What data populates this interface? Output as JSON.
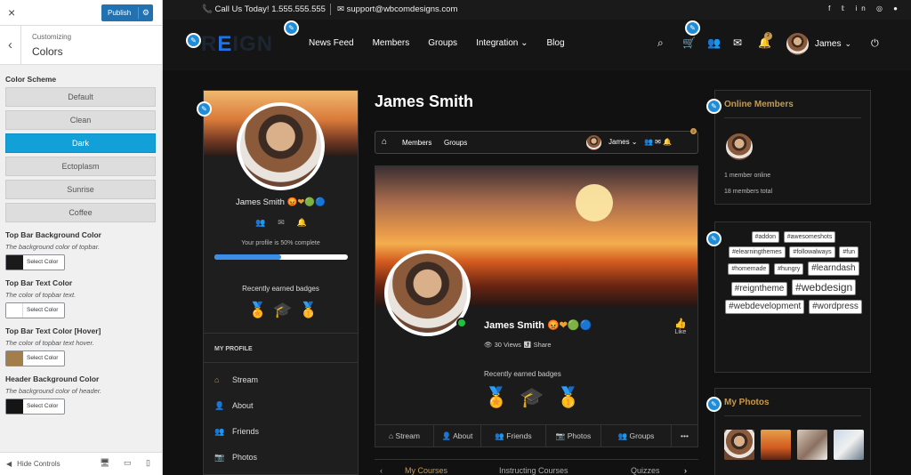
{
  "customizer": {
    "close_icon": "×",
    "publish_label": "Publish",
    "publish_gear": "⚙",
    "back_icon": "‹",
    "subtitle": "Customizing",
    "title": "Colors",
    "scheme_label": "Color Scheme",
    "schemes": [
      "Default",
      "Clean",
      "Dark",
      "Ectoplasm",
      "Sunrise",
      "Coffee"
    ],
    "selected_scheme": "Dark",
    "color_options": [
      {
        "title": "Top Bar Background Color",
        "desc": "The background color of topbar.",
        "swatch": "#1a1a1a",
        "button": "Select Color"
      },
      {
        "title": "Top Bar Text Color",
        "desc": "The color of topbar text.",
        "swatch": "#ffffff",
        "button": "Select Color"
      },
      {
        "title": "Top Bar Text Color [Hover]",
        "desc": "The color of topbar text hover.",
        "swatch": "#a47e4a",
        "button": "Select Color"
      },
      {
        "title": "Header Background Color",
        "desc": "The background color of header.",
        "swatch": "#151515",
        "button": "Select Color"
      }
    ],
    "hide_controls": "Hide Controls",
    "hide_icon": "◀",
    "device_icons": [
      "🖥",
      "▭",
      "▯"
    ]
  },
  "topbar": {
    "phone_icon": "📞",
    "call": "Call Us Today! 1.555.555.555",
    "mail_icon": "✉",
    "email": "support@wbcomdesigns.com",
    "social": "f 𝕥 in ◎ ●"
  },
  "header": {
    "logo_prefix": "R",
    "logo_highlight": "E",
    "logo_rest": "IGN",
    "nav": [
      "News Feed",
      "Members",
      "Groups",
      "Integration ⌄",
      "Blog"
    ],
    "icons": [
      "⌕",
      "🛒",
      "👥",
      "✉",
      "🔔"
    ],
    "notification_count": "2",
    "user_name": "James",
    "user_chevron": "⌄",
    "power_icon": "⏻"
  },
  "edit_icon": "✎",
  "profile_card": {
    "name": "James Smith",
    "name_emojis": "😡❤🟢🔵",
    "action_icons": "👥✉🔔",
    "completion_text": "Your profile is 50% complete",
    "completion_percent": 50,
    "badges_title": "Recently earned badges",
    "badges": [
      "🏅",
      "🎓",
      "🥇"
    ],
    "section": "MY PROFILE",
    "menu": [
      {
        "icon": "⌂",
        "label": "Stream"
      },
      {
        "icon": "👤",
        "label": "About"
      },
      {
        "icon": "👥",
        "label": "Friends"
      },
      {
        "icon": "📷",
        "label": "Photos"
      }
    ]
  },
  "main": {
    "page_title": "James Smith",
    "mini_nav": {
      "home_icon": "⌂",
      "links": [
        "Members",
        "Groups"
      ],
      "user": "James ⌄",
      "icons": "👥 ✉ 🔔",
      "badge": "2"
    },
    "name": "James Smith",
    "name_emojis": "😡❤🟢🔵",
    "views": "👁 30 Views   ⤴ Share",
    "like_icon": "👍",
    "like": "Like",
    "badges_title": "Recently earned badges",
    "badges": [
      "🏅",
      "🎓",
      "🥇"
    ],
    "tabs": [
      "⌂ Stream",
      "👤 About",
      "👥 Friends",
      "📷 Photos",
      "👥 Groups",
      "•••"
    ],
    "lower_tabs": [
      "‹",
      "My Courses",
      "Instructing Courses",
      "Quizzes",
      "›"
    ]
  },
  "sidebar": {
    "online_title": "Online Members",
    "online_count": "1 member online",
    "members_total": "18 members total",
    "tags": [
      {
        "label": "#addon",
        "size": 7
      },
      {
        "label": "#awesomeshots",
        "size": 7
      },
      {
        "label": "#elearningthemes",
        "size": 7
      },
      {
        "label": "#followalways",
        "size": 7
      },
      {
        "label": "#fun",
        "size": 7
      },
      {
        "label": "#homemade",
        "size": 7
      },
      {
        "label": "#hungry",
        "size": 7
      },
      {
        "label": "#learndash",
        "size": 10
      },
      {
        "label": "#reigntheme",
        "size": 10
      },
      {
        "label": "#webdesign",
        "size": 12
      },
      {
        "label": "#webdevelopment",
        "size": 10
      },
      {
        "label": "#wordpress",
        "size": 10
      }
    ],
    "photos_title": "My Photos"
  },
  "colors": {
    "accent": "#c89a4a",
    "wp_blue": "#2271b1",
    "scheme_active": "#12a0d8",
    "online": "#1fc33c"
  }
}
